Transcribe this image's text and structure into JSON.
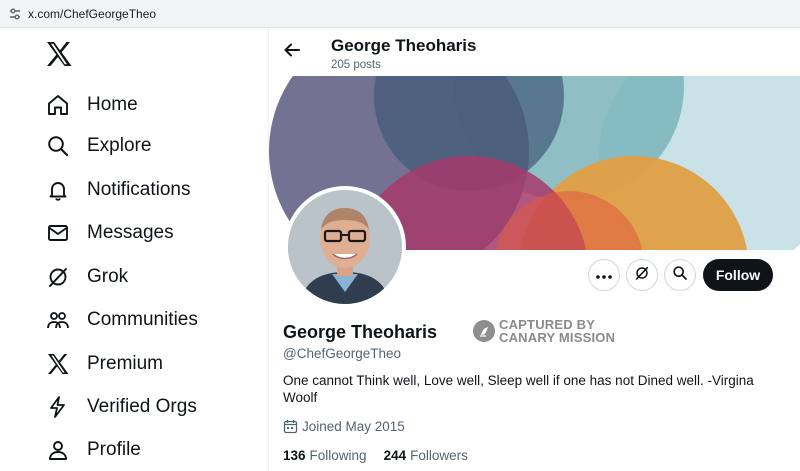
{
  "browser": {
    "url": "x.com/ChefGeorgeTheo"
  },
  "sidebar": {
    "logo": "x-logo",
    "items": [
      {
        "label": "Home",
        "icon": "home-icon"
      },
      {
        "label": "Explore",
        "icon": "search-icon"
      },
      {
        "label": "Notifications",
        "icon": "bell-icon"
      },
      {
        "label": "Messages",
        "icon": "envelope-icon"
      },
      {
        "label": "Grok",
        "icon": "grok-icon"
      },
      {
        "label": "Communities",
        "icon": "people-icon"
      },
      {
        "label": "Premium",
        "icon": "x-logo-icon"
      },
      {
        "label": "Verified Orgs",
        "icon": "lightning-icon"
      },
      {
        "label": "Profile",
        "icon": "person-icon"
      }
    ]
  },
  "header": {
    "name": "George Theoharis",
    "post_count": "205 posts"
  },
  "profile": {
    "display_name": "George Theoharis",
    "handle": "@ChefGeorgeTheo",
    "badge": {
      "line1": "CAPTURED BY",
      "line2": "CANARY MISSION"
    },
    "bio": "One cannot Think well, Love well, Sleep well if one has not Dined well. -Virgina Woolf",
    "joined": "Joined May 2015",
    "following_count": "136",
    "following_label": "Following",
    "followers_count": "244",
    "followers_label": "Followers"
  },
  "actions": {
    "follow_label": "Follow"
  },
  "colors": {
    "follow_bg": "#0f1419",
    "secondary_text": "#536471",
    "banner_purple": "#6b6a8d",
    "banner_teal": "#7bb4bb",
    "banner_lightblue": "#c9e2e8",
    "banner_magenta": "#a63a6a",
    "banner_orange": "#e29f45",
    "banner_navy": "#3f5a76"
  }
}
